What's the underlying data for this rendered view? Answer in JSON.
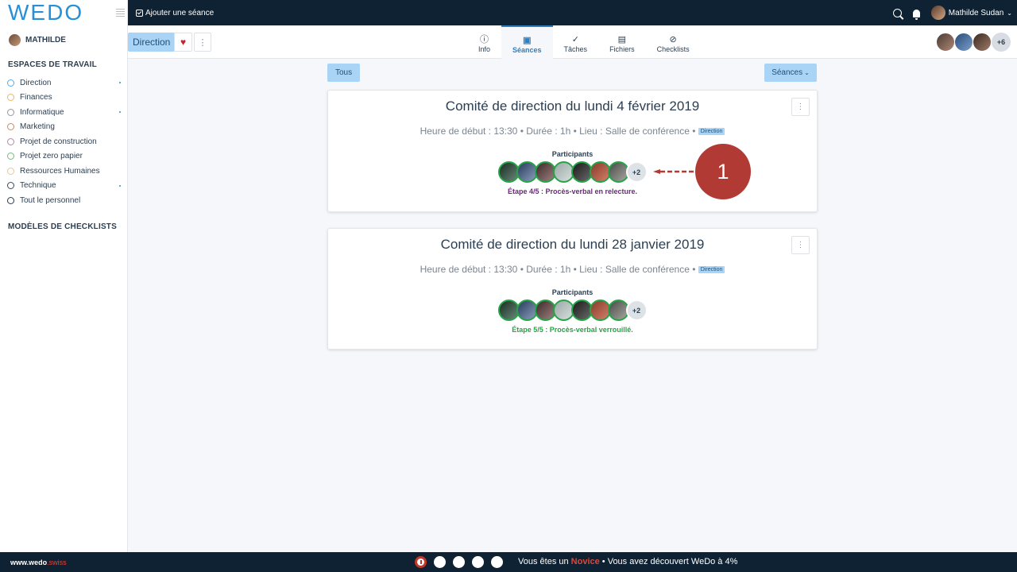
{
  "app": {
    "logo": "WEDO",
    "footer_url_main": "www.wedo",
    "footer_url_tld": ".swiss"
  },
  "sidebar": {
    "user": "MATHILDE",
    "workspaces_title": "ESPACES DE TRAVAIL",
    "workspaces": [
      {
        "label": "Direction",
        "color": "#5aa8e6",
        "dot": true
      },
      {
        "label": "Finances",
        "color": "#e8b86a",
        "dot": false
      },
      {
        "label": "Informatique",
        "color": "#8a9aa8",
        "dot": true
      },
      {
        "label": "Marketing",
        "color": "#d9845a",
        "dot": false
      },
      {
        "label": "Projet de construction",
        "color": "#b08aa8",
        "dot": false
      },
      {
        "label": "Projet zero papier",
        "color": "#7ab87a",
        "dot": false
      },
      {
        "label": "Ressources Humaines",
        "color": "#e8c88a",
        "dot": false
      },
      {
        "label": "Technique",
        "color": "#3a4a5a",
        "dot": true
      },
      {
        "label": "Tout le personnel",
        "color": "#2c3e50",
        "dot": false
      }
    ],
    "checklists_title": "MODÈLES DE CHECKLISTS"
  },
  "topbar": {
    "add_seance": "Ajouter une séance",
    "user_name": "Mathilde Sudan"
  },
  "subnav": {
    "workspace": "Direction",
    "tabs": [
      {
        "label": "Info",
        "icon": "info-icon",
        "glyph": "ⓘ"
      },
      {
        "label": "Séances",
        "icon": "calendar-check-icon",
        "glyph": "▣"
      },
      {
        "label": "Tâches",
        "icon": "check-icon",
        "glyph": "✓"
      },
      {
        "label": "Fichiers",
        "icon": "file-icon",
        "glyph": "▤"
      },
      {
        "label": "Checklists",
        "icon": "checklist-icon",
        "glyph": "⊘"
      }
    ],
    "members_more": "+6"
  },
  "filters": {
    "all": "Tous",
    "type": "Séances"
  },
  "meetings": [
    {
      "title": "Comité de direction du lundi 4 février 2019",
      "meta": "Heure de début : 13:30 • Durée : 1h • Lieu : Salle de conférence •",
      "tag": "Direction",
      "participants_label": "Participants",
      "participants_more": "+2",
      "step": "Étape 4/5 : Procès-verbal en relecture.",
      "step_color": "#6a2a7a"
    },
    {
      "title": "Comité de direction du lundi 28 janvier 2019",
      "meta": "Heure de début : 13:30 • Durée : 1h • Lieu : Salle de conférence •",
      "tag": "Direction",
      "participants_label": "Participants",
      "participants_more": "+2",
      "step": "Étape 5/5 : Procès-verbal verrouillé.",
      "step_color": "#27a348"
    }
  ],
  "annotation": {
    "number": "1"
  },
  "footer": {
    "msg_before": "Vous êtes un ",
    "level": "Novice",
    "msg_after": " • Vous avez découvert WeDo à 4%"
  }
}
